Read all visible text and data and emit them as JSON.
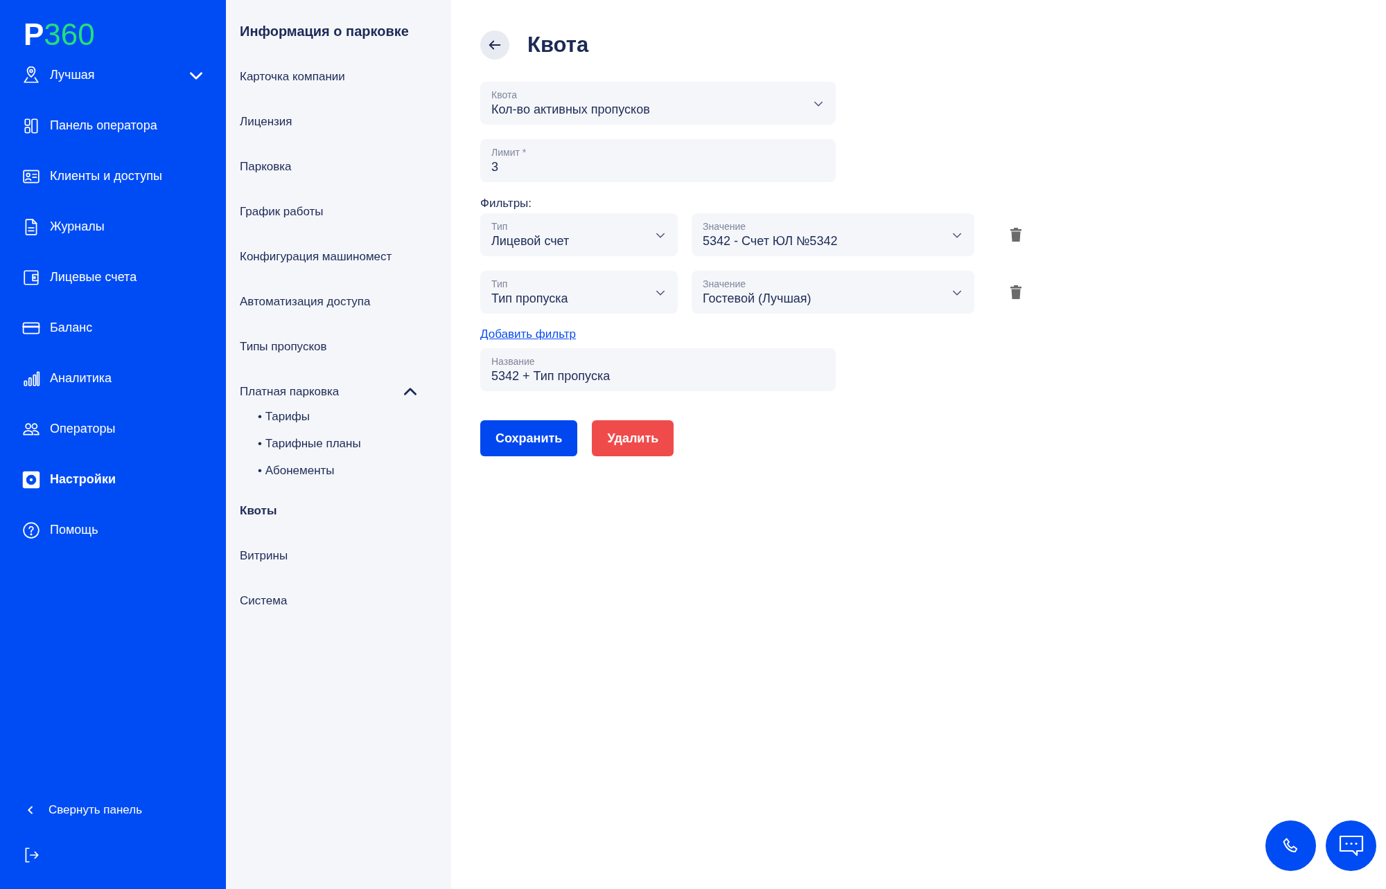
{
  "sidebar": {
    "logo": {
      "letter": "P",
      "number": "360"
    },
    "items": [
      {
        "label": "Лучшая",
        "selected": false,
        "kind": "dropdown",
        "expanded": false
      },
      {
        "label": "Панель оператора",
        "selected": false,
        "kind": "link"
      },
      {
        "label": "Клиенты и доступы",
        "selected": false,
        "kind": "link"
      },
      {
        "label": "Журналы",
        "selected": false,
        "kind": "link"
      },
      {
        "label": "Лицевые счета",
        "selected": false,
        "kind": "link"
      },
      {
        "label": "Баланс",
        "selected": false,
        "kind": "link"
      },
      {
        "label": "Аналитика",
        "selected": false,
        "kind": "link"
      },
      {
        "label": "Операторы",
        "selected": false,
        "kind": "link"
      },
      {
        "label": "Настройки",
        "selected": true,
        "kind": "link"
      },
      {
        "label": "Помощь",
        "selected": false,
        "kind": "link"
      }
    ],
    "collapse": "Свернуть панель"
  },
  "settings_nav": {
    "title": "Информация о парковке",
    "items": [
      {
        "label": "Карточка компании",
        "selected": false
      },
      {
        "label": "Лицензия",
        "selected": false
      },
      {
        "label": "Парковка",
        "selected": false
      },
      {
        "label": "График работы",
        "selected": false
      },
      {
        "label": "Конфигурация машиномест",
        "selected": false
      },
      {
        "label": "Автоматизация доступа",
        "selected": false
      },
      {
        "label": "Типы пропусков",
        "selected": false
      },
      {
        "label": "Платная парковка",
        "selected": false,
        "expanded": true,
        "children": [
          {
            "label": "• Тарифы",
            "selected": false
          },
          {
            "label": "• Тарифные планы",
            "selected": false
          },
          {
            "label": "• Абонементы",
            "selected": false
          }
        ]
      },
      {
        "label": "Квоты",
        "selected": true
      },
      {
        "label": "Витрины",
        "selected": false
      },
      {
        "label": "Система",
        "selected": false
      }
    ]
  },
  "page": {
    "title": "Квота",
    "quota": {
      "label": "Квота",
      "value": "Кол-во активных пропусков"
    },
    "limit": {
      "label": "Лимит *",
      "value": "3"
    },
    "filters_label": "Фильтры:",
    "filters": [
      {
        "type": {
          "label": "Тип",
          "value": "Лицевой счет"
        },
        "value": {
          "label": "Значение",
          "value": "5342 - Счет ЮЛ №5342"
        }
      },
      {
        "type": {
          "label": "Тип",
          "value": "Тип пропуска"
        },
        "value": {
          "label": "Значение",
          "value": "Гостевой (Лучшая)"
        }
      }
    ],
    "add_filter": "Добавить фильтр",
    "name": {
      "label": "Название",
      "value": "5342 + Тип пропуска"
    },
    "buttons": [
      {
        "label": "Сохранить",
        "kind": "primary"
      },
      {
        "label": "Удалить",
        "kind": "danger"
      }
    ]
  }
}
